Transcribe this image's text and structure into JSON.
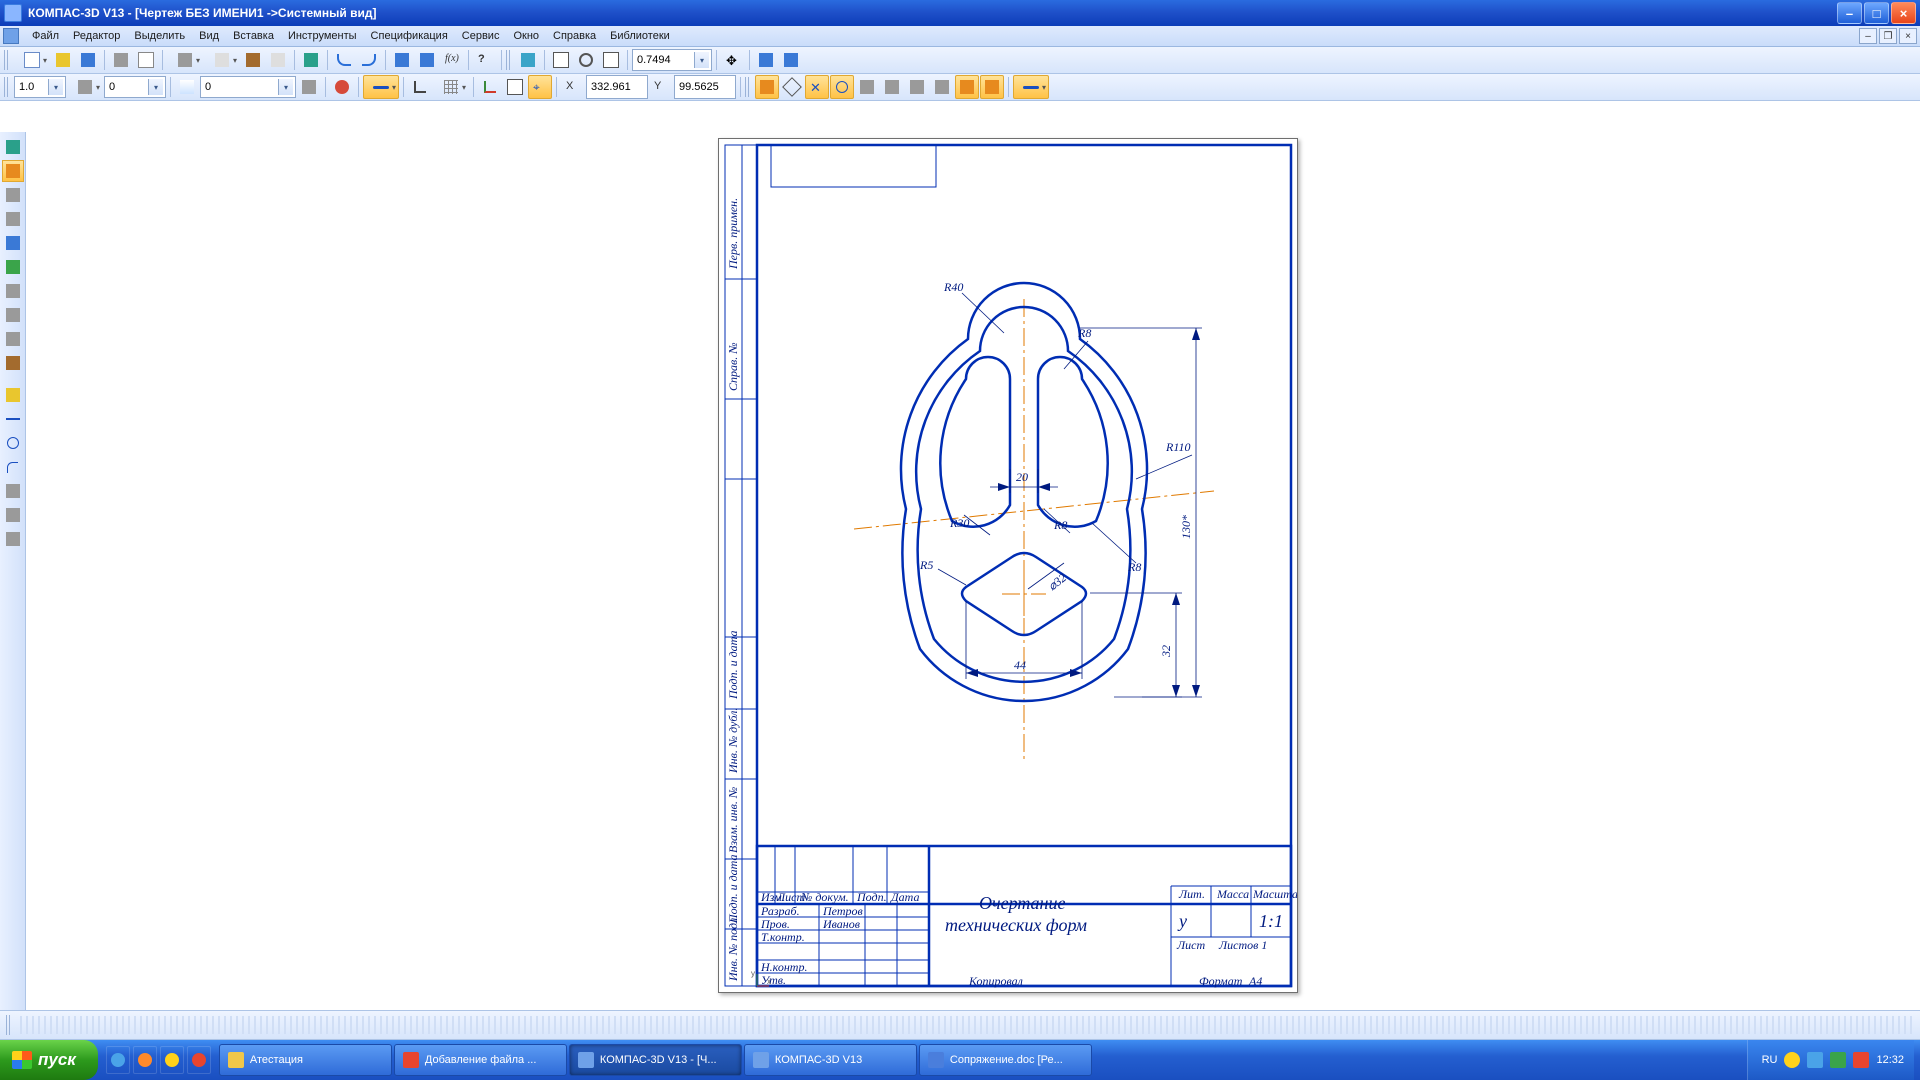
{
  "title": "КОМПАС-3D V13 - [Чертеж БЕЗ ИМЕНИ1 ->Системный вид]",
  "menu": [
    "Файл",
    "Редактор",
    "Выделить",
    "Вид",
    "Вставка",
    "Инструменты",
    "Спецификация",
    "Сервис",
    "Окно",
    "Справка",
    "Библиотеки"
  ],
  "zoom": "0.7494",
  "step": "1.0",
  "angle": "0",
  "style": "0",
  "coord_x": "332.961",
  "coord_y": "99.5625",
  "drawing": {
    "title_1": "Очертание",
    "title_2": "технических форм",
    "hdr_lit": "Лит.",
    "hdr_mass": "Масса",
    "hdr_scale": "Масштаб",
    "scale": "1:1",
    "lit_val": "у",
    "hdr_sheet": "Лист",
    "hdr_sheets": "Листов     1",
    "role_dev": "Разраб.",
    "role_chk": "Пров.",
    "role_tk": "Т.контр.",
    "role_nk": "Н.контр.",
    "role_utv": "Утв.",
    "name_dev": "Петров",
    "name_chk": "Иванов",
    "col_izm": "Изм.",
    "col_list": "Лист",
    "col_doc": "№ докум.",
    "col_sign": "Подп.",
    "col_date": "Дата",
    "kopiroval": "Копировал",
    "format": "Формат",
    "format_v": "А4",
    "side_perv": "Перв. примен.",
    "side_sprav": "Справ. №",
    "side_pd1": "Подп. и дата",
    "side_inv": "Инв. № дубл.",
    "side_vzam": "Взам. инв. №",
    "side_pd2": "Подп. и дата",
    "side_inv2": "Инв. № подл."
  },
  "dims": {
    "r40": "R40",
    "r8a": "R8",
    "r110": "R110",
    "d20": "20",
    "r30": "R30",
    "r8b": "R8",
    "r8c": "R8",
    "r5": "R5",
    "d32": "⌀32",
    "w44": "44",
    "h32": "32",
    "h130": "130*"
  },
  "taskbar": {
    "start": "пуск",
    "tasks": [
      {
        "label": "Атестация",
        "color": "#f0c74a"
      },
      {
        "label": "Добавление файла ...",
        "color": "#e8452e"
      },
      {
        "label": "КОМПАС-3D V13 - [Ч...",
        "color": "#6fa1e8",
        "active": true
      },
      {
        "label": "КОМПАС-3D V13",
        "color": "#6fa1e8"
      },
      {
        "label": "Сопряжение.doc [Ре...",
        "color": "#4a7edc"
      }
    ],
    "lang": "RU",
    "clock": "12:32"
  }
}
